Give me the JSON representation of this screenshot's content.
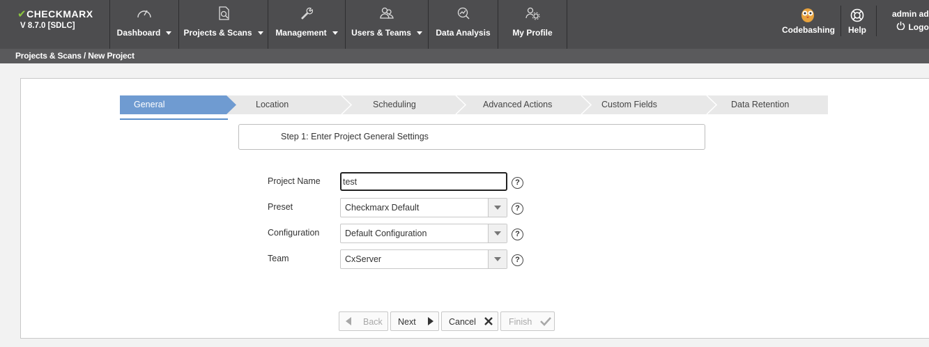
{
  "brand": {
    "logo": "CHECKMARX",
    "version": "V 8.7.0  [SDLC]"
  },
  "nav": {
    "items": [
      {
        "label": "Dashboard",
        "icon": "gauge-icon"
      },
      {
        "label": "Projects & Scans",
        "icon": "document-search-icon"
      },
      {
        "label": "Management",
        "icon": "wrench-icon"
      },
      {
        "label": "Users & Teams",
        "icon": "users-icon"
      },
      {
        "label": "Data Analysis",
        "icon": "chart-search-icon"
      },
      {
        "label": "My Profile",
        "icon": "user-gear-icon"
      }
    ],
    "codebashing": "Codebashing",
    "help": "Help",
    "user": "admin adm",
    "logout": "Logou"
  },
  "breadcrumb": "Projects & Scans / New Project",
  "wizard": {
    "steps": [
      "General",
      "Location",
      "Scheduling",
      "Advanced Actions",
      "Custom Fields",
      "Data Retention"
    ],
    "active_color": "#6f9bd1",
    "inactive_color": "#e8e8e8"
  },
  "step_title": "Step 1: Enter Project General Settings",
  "form": {
    "project_name_label": "Project Name",
    "project_name_value": "test",
    "preset_label": "Preset",
    "preset_value": "Checkmarx Default",
    "configuration_label": "Configuration",
    "configuration_value": "Default Configuration",
    "team_label": "Team",
    "team_value": "CxServer",
    "help_glyph": "?"
  },
  "buttons": {
    "back": "Back",
    "next": "Next",
    "cancel": "Cancel",
    "finish": "Finish"
  }
}
